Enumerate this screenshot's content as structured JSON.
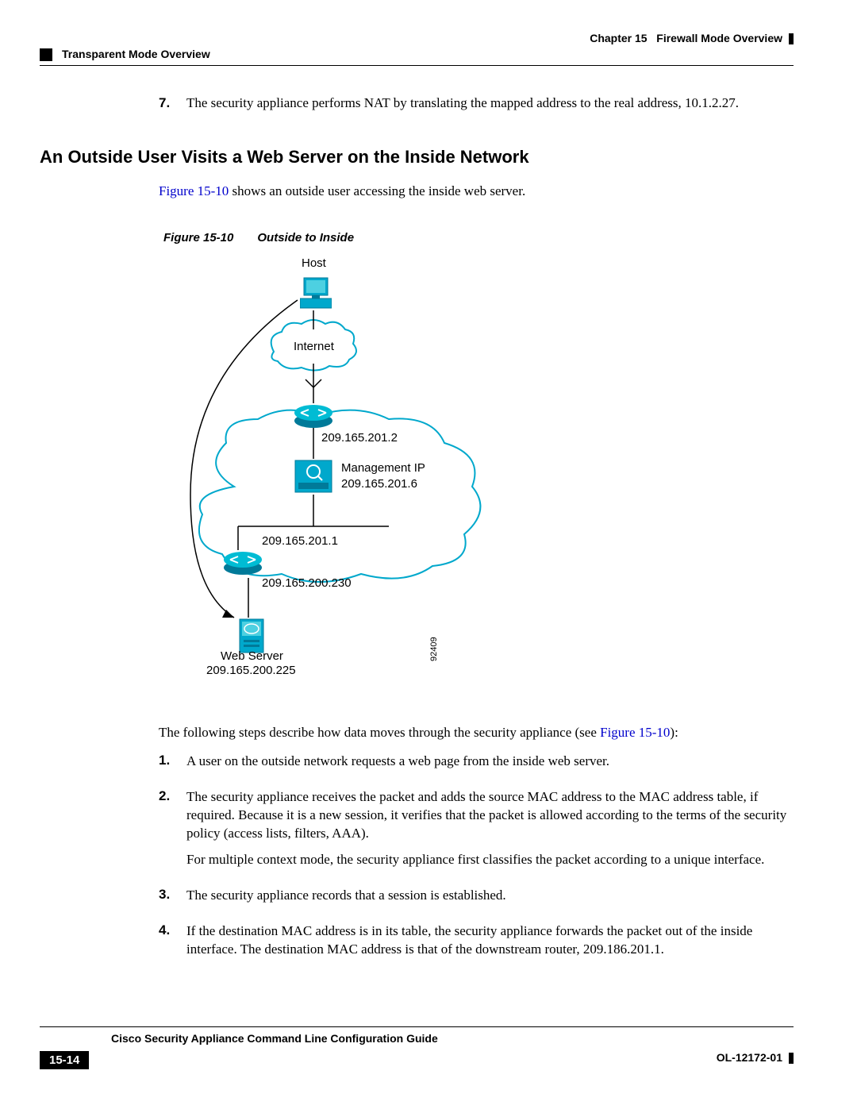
{
  "header": {
    "chapter_label": "Chapter 15",
    "chapter_title": "Firewall Mode Overview",
    "section_title": "Transparent Mode Overview"
  },
  "continuation": {
    "num": "7.",
    "text": "The security appliance performs NAT by translating the mapped address to the real address, 10.1.2.27."
  },
  "heading": "An Outside User Visits a Web Server on the Inside Network",
  "intro": {
    "link": "Figure 15-10",
    "text": " shows an outside user accessing the inside web server."
  },
  "figure": {
    "number": "Figure 15-10",
    "title": "Outside to Inside",
    "labels": {
      "host": "Host",
      "internet": "Internet",
      "ip1": "209.165.201.2",
      "mgmt_label": "Management IP",
      "mgmt_ip": "209.165.201.6",
      "ip2": "209.165.201.1",
      "ip3": "209.165.200.230",
      "server_label": "Web Server",
      "server_ip": "209.165.200.225",
      "image_id": "92409"
    }
  },
  "below_intro": {
    "text_before": "The following steps describe how data moves through the security appliance (see ",
    "link": "Figure 15-10",
    "text_after": "):"
  },
  "steps": [
    {
      "num": "1.",
      "paras": [
        "A user on the outside network requests a web page from the inside web server."
      ]
    },
    {
      "num": "2.",
      "paras": [
        "The security appliance receives the packet and adds the source MAC address to the MAC address table, if required. Because it is a new session, it verifies that the packet is allowed according to the terms of the security policy (access lists, filters, AAA).",
        "For multiple context mode, the security appliance first classifies the packet according to a unique interface."
      ]
    },
    {
      "num": "3.",
      "paras": [
        "The security appliance records that a session is established."
      ]
    },
    {
      "num": "4.",
      "paras": [
        "If the destination MAC address is in its table, the security appliance forwards the packet out of the inside interface. The destination MAC address is that of the downstream router, 209.186.201.1."
      ]
    }
  ],
  "footer": {
    "guide_title": "Cisco Security Appliance Command Line Configuration Guide",
    "page_num": "15-14",
    "doc_id": "OL-12172-01"
  }
}
